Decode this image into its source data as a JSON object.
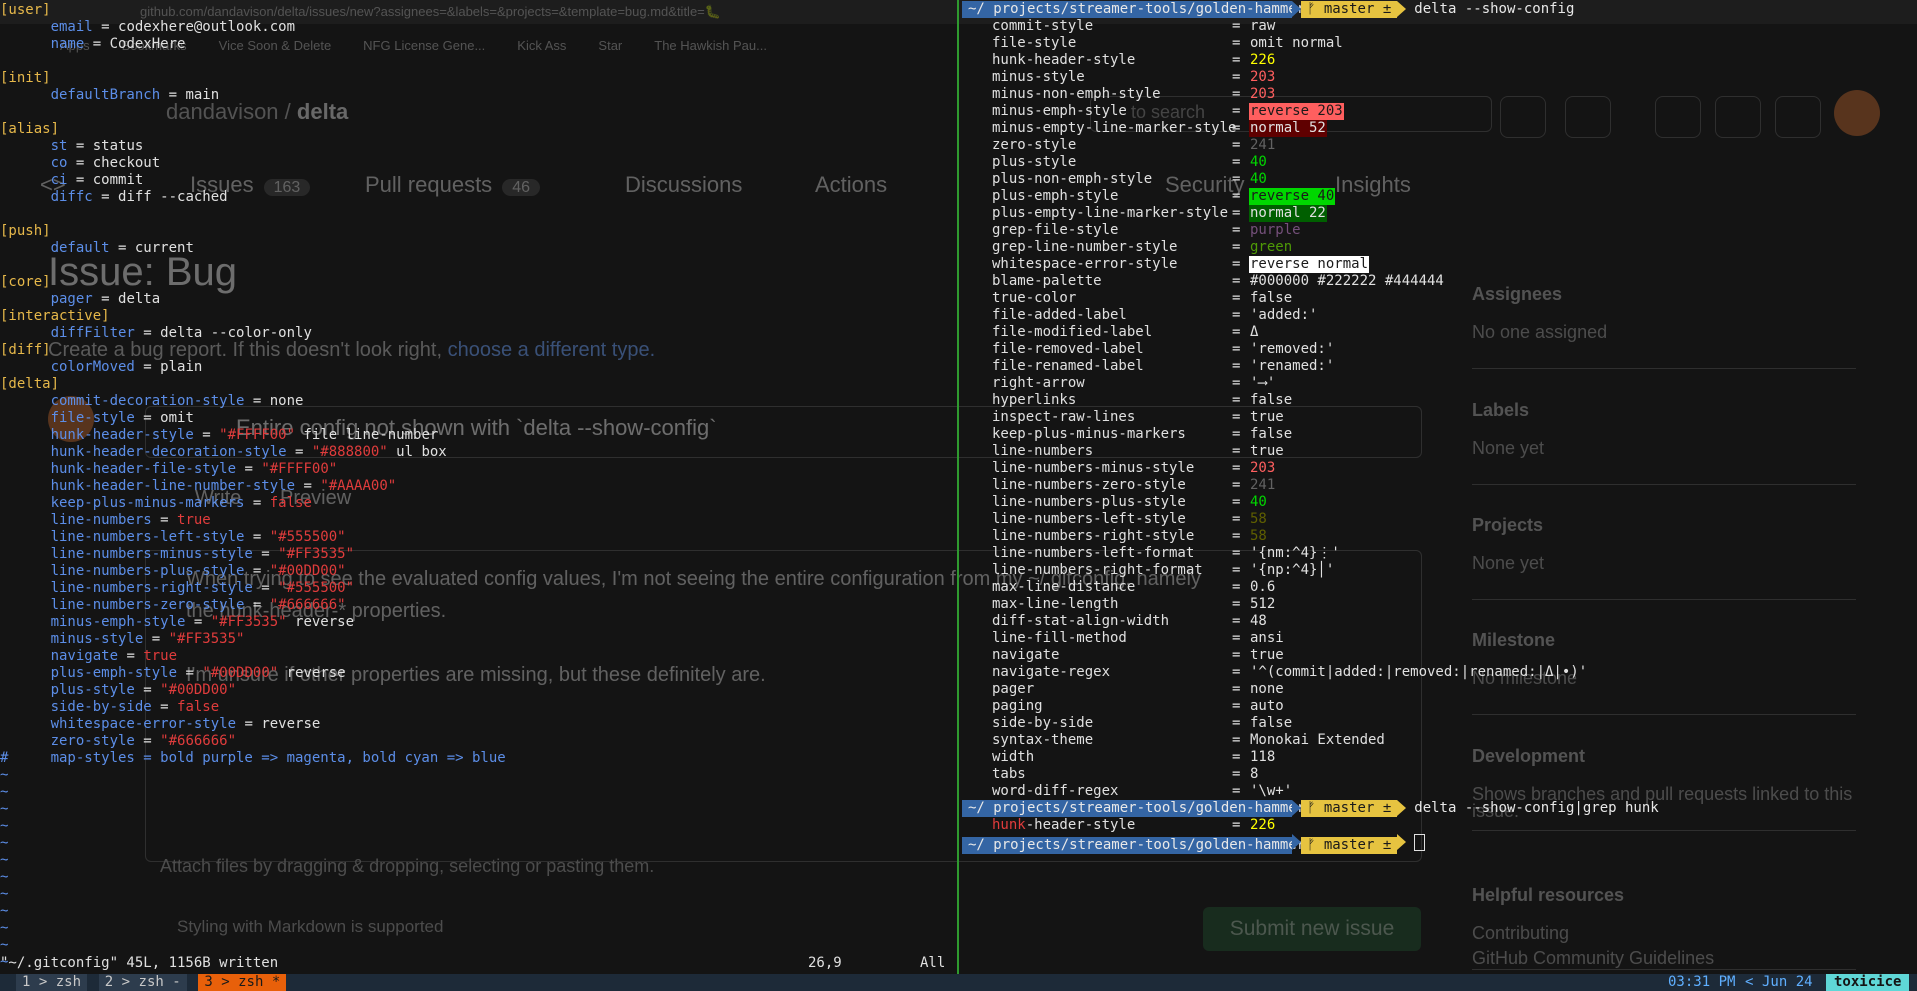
{
  "browser": {
    "url": "github.com/dandavison/delta/issues/new?assignees=&labels=&projects=&template=bug.md&title=🐛",
    "bookmarks": [
      "Apps",
      "Bookmarks",
      "Vice Soon & Delete",
      "NFG License Gene...",
      "Kick Ass",
      "Star",
      "The Hawkish Pau..."
    ],
    "owner": "dandavison",
    "repo_sep": "/",
    "repo": "delta",
    "search_placeholder": "to search",
    "nav": [
      {
        "label": "<>",
        "count": ""
      },
      {
        "label": "Issues",
        "count": "163"
      },
      {
        "label": "Pull requests",
        "count": "46"
      },
      {
        "label": "Discussions",
        "count": ""
      },
      {
        "label": "Actions",
        "count": ""
      },
      {
        "label": "Security",
        "count": ""
      },
      {
        "label": "Insights",
        "count": ""
      }
    ],
    "issue_title": "Issue: Bug",
    "issue_sub": "Create a bug report. If this doesn't look right,",
    "issue_sub_link": "choose a different type.",
    "title_value": "Entire config not shown with `delta --show-config`",
    "tabs": [
      "Write",
      "Preview"
    ],
    "body_lines": [
      "When trying to see the evaluated config values, I'm not seeing the entire configuration from my ~/.gitconfig, namely",
      "the hunk-header-* properties.",
      "",
      "I'm unsure if other properties are missing, but these definitely are."
    ],
    "attach_text": "Attach files by dragging & dropping, selecting or pasting them.",
    "markdown_note": "Styling with Markdown is supported",
    "submit_label": "Submit new issue",
    "sidebar": [
      {
        "heading": "Assignees",
        "value": "No one assigned"
      },
      {
        "heading": "Labels",
        "value": "None yet"
      },
      {
        "heading": "Projects",
        "value": "None yet"
      },
      {
        "heading": "Milestone",
        "value": "No milestone"
      },
      {
        "heading": "Development",
        "value": "Shows branches and pull requests linked to this issue."
      },
      {
        "heading": "Helpful resources",
        "value": "Contributing"
      },
      {
        "heading": "",
        "value": "GitHub Community Guidelines"
      }
    ]
  },
  "vim": {
    "lines": [
      [
        {
          "t": "[user]",
          "c": "hdr"
        }
      ],
      [
        {
          "t": "      email",
          "c": "key"
        },
        {
          "t": " = ",
          "c": "eq"
        },
        {
          "t": "codexhere@outlook.com",
          "c": "val"
        }
      ],
      [
        {
          "t": "      name",
          "c": "key"
        },
        {
          "t": " = ",
          "c": "eq"
        },
        {
          "t": "CodexHere",
          "c": "val"
        }
      ],
      [],
      [
        {
          "t": "[init]",
          "c": "hdr"
        }
      ],
      [
        {
          "t": "      defaultBranch",
          "c": "key"
        },
        {
          "t": " = ",
          "c": "eq"
        },
        {
          "t": "main",
          "c": "val"
        }
      ],
      [],
      [
        {
          "t": "[alias]",
          "c": "hdr"
        }
      ],
      [
        {
          "t": "      st",
          "c": "key"
        },
        {
          "t": " = ",
          "c": "eq"
        },
        {
          "t": "status",
          "c": "val"
        }
      ],
      [
        {
          "t": "      co",
          "c": "key"
        },
        {
          "t": " = ",
          "c": "eq"
        },
        {
          "t": "checkout",
          "c": "val"
        }
      ],
      [
        {
          "t": "      ci",
          "c": "key"
        },
        {
          "t": " = ",
          "c": "eq"
        },
        {
          "t": "commit",
          "c": "val"
        }
      ],
      [
        {
          "t": "      diffc",
          "c": "key"
        },
        {
          "t": " = ",
          "c": "eq"
        },
        {
          "t": "diff --cached",
          "c": "val"
        }
      ],
      [],
      [
        {
          "t": "[push]",
          "c": "hdr"
        }
      ],
      [
        {
          "t": "      default",
          "c": "key"
        },
        {
          "t": " = ",
          "c": "eq"
        },
        {
          "t": "current",
          "c": "val"
        }
      ],
      [],
      [
        {
          "t": "[core]",
          "c": "hdr"
        }
      ],
      [
        {
          "t": "      pager",
          "c": "key"
        },
        {
          "t": " = ",
          "c": "eq"
        },
        {
          "t": "delta",
          "c": "val"
        }
      ],
      [
        {
          "t": "[interactive]",
          "c": "hdr"
        }
      ],
      [
        {
          "t": "      diffFilter",
          "c": "key"
        },
        {
          "t": " = ",
          "c": "eq"
        },
        {
          "t": "delta --color-only",
          "c": "val"
        }
      ],
      [
        {
          "t": "[diff]",
          "c": "hdr"
        }
      ],
      [
        {
          "t": "      colorMoved",
          "c": "key"
        },
        {
          "t": " = ",
          "c": "eq"
        },
        {
          "t": "plain",
          "c": "val"
        }
      ],
      [
        {
          "t": "[delta]",
          "c": "hdr"
        }
      ],
      [
        {
          "t": "      commit-decoration-style",
          "c": "key"
        },
        {
          "t": " = ",
          "c": "eq"
        },
        {
          "t": "none",
          "c": "val"
        }
      ],
      [
        {
          "t": "      file-style",
          "c": "key"
        },
        {
          "t": " = ",
          "c": "eq"
        },
        {
          "t": "omit",
          "c": "val"
        }
      ],
      [
        {
          "t": "      hunk-header-style",
          "c": "key"
        },
        {
          "t": " = ",
          "c": "eq"
        },
        {
          "t": "\"#FFFF00\"",
          "c": "str"
        },
        {
          "t": " file line-number",
          "c": "val"
        }
      ],
      [
        {
          "t": "      hunk-header-decoration-style",
          "c": "key"
        },
        {
          "t": " = ",
          "c": "eq"
        },
        {
          "t": "\"#888800\"",
          "c": "str"
        },
        {
          "t": " ul box",
          "c": "val"
        }
      ],
      [
        {
          "t": "      hunk-header-file-style",
          "c": "key"
        },
        {
          "t": " = ",
          "c": "eq"
        },
        {
          "t": "\"#FFFF00\"",
          "c": "str"
        }
      ],
      [
        {
          "t": "      hunk-header-line-number-style",
          "c": "key"
        },
        {
          "t": " = ",
          "c": "eq"
        },
        {
          "t": "\"#AAAA00\"",
          "c": "str"
        }
      ],
      [
        {
          "t": "      keep-plus-minus-markers",
          "c": "key"
        },
        {
          "t": " = ",
          "c": "eq"
        },
        {
          "t": "false",
          "c": "bool"
        }
      ],
      [
        {
          "t": "      line-numbers",
          "c": "key"
        },
        {
          "t": " = ",
          "c": "eq"
        },
        {
          "t": "true",
          "c": "bool"
        }
      ],
      [
        {
          "t": "      line-numbers-left-style",
          "c": "key"
        },
        {
          "t": " = ",
          "c": "eq"
        },
        {
          "t": "\"#555500\"",
          "c": "str"
        }
      ],
      [
        {
          "t": "      line-numbers-minus-style",
          "c": "key"
        },
        {
          "t": " = ",
          "c": "eq"
        },
        {
          "t": "\"#FF3535\"",
          "c": "str"
        }
      ],
      [
        {
          "t": "      line-numbers-plus-style",
          "c": "key"
        },
        {
          "t": " = ",
          "c": "eq"
        },
        {
          "t": "\"#00DD00\"",
          "c": "str"
        }
      ],
      [
        {
          "t": "      line-numbers-right-style",
          "c": "key"
        },
        {
          "t": " = ",
          "c": "eq"
        },
        {
          "t": "\"#555500\"",
          "c": "str"
        }
      ],
      [
        {
          "t": "      line-numbers-zero-style",
          "c": "key"
        },
        {
          "t": " = ",
          "c": "eq"
        },
        {
          "t": "\"#666666\"",
          "c": "str"
        }
      ],
      [
        {
          "t": "      minus-emph-style",
          "c": "key"
        },
        {
          "t": " = ",
          "c": "eq"
        },
        {
          "t": "\"#FF3535\"",
          "c": "str"
        },
        {
          "t": " reverse",
          "c": "val"
        }
      ],
      [
        {
          "t": "      minus-style",
          "c": "key"
        },
        {
          "t": " = ",
          "c": "eq"
        },
        {
          "t": "\"#FF3535\"",
          "c": "str"
        }
      ],
      [
        {
          "t": "      navigate",
          "c": "key"
        },
        {
          "t": " = ",
          "c": "eq"
        },
        {
          "t": "true",
          "c": "bool"
        }
      ],
      [
        {
          "t": "      plus-emph-style",
          "c": "key"
        },
        {
          "t": " = ",
          "c": "eq"
        },
        {
          "t": "\"#00DD00\"",
          "c": "str"
        },
        {
          "t": " reverse",
          "c": "val"
        }
      ],
      [
        {
          "t": "      plus-style",
          "c": "key"
        },
        {
          "t": " = ",
          "c": "eq"
        },
        {
          "t": "\"#00DD00\"",
          "c": "str"
        }
      ],
      [
        {
          "t": "      side-by-side",
          "c": "key"
        },
        {
          "t": " = ",
          "c": "eq"
        },
        {
          "t": "false",
          "c": "bool"
        }
      ],
      [
        {
          "t": "      whitespace-error-style",
          "c": "key"
        },
        {
          "t": " = ",
          "c": "eq"
        },
        {
          "t": "reverse",
          "c": "val"
        }
      ],
      [
        {
          "t": "      zero-style",
          "c": "key"
        },
        {
          "t": " = ",
          "c": "eq"
        },
        {
          "t": "\"#666666\"",
          "c": "str"
        }
      ],
      [
        {
          "t": "#     map-styles = bold purple => magenta, bold cyan => blue",
          "c": "cmt"
        }
      ]
    ],
    "tilde_count": 12,
    "tilde": "~",
    "status_file": "\"~/.gitconfig\" 45L, 1156B written",
    "status_pos": "26,9",
    "status_scroll": "All"
  },
  "delta": {
    "prompt_dir": "~/ projects/streamer-tools/golden-hammer",
    "prompt_branch": "ᚠ master ±",
    "cmd1": "delta --show-config",
    "config": [
      {
        "k": "commit-style",
        "v": "raw",
        "fg": "",
        "bg": ""
      },
      {
        "k": "file-style",
        "v": "omit normal",
        "fg": "",
        "bg": ""
      },
      {
        "k": "hunk-header-style",
        "v": "226",
        "fg": "#ffff00",
        "bg": ""
      },
      {
        "k": "minus-style",
        "v": "203",
        "fg": "#ff5f5f",
        "bg": ""
      },
      {
        "k": "minus-non-emph-style",
        "v": "203",
        "fg": "#ff5f5f",
        "bg": ""
      },
      {
        "k": "minus-emph-style",
        "v": "reverse 203",
        "fg": "#1a1a1a",
        "bg": "#ff5f5f"
      },
      {
        "k": "minus-empty-line-marker-style",
        "v": "normal 52",
        "fg": "#e0e0e0",
        "bg": "#5f0000"
      },
      {
        "k": "zero-style",
        "v": "241",
        "fg": "#626262",
        "bg": ""
      },
      {
        "k": "plus-style",
        "v": "40",
        "fg": "#00d700",
        "bg": ""
      },
      {
        "k": "plus-non-emph-style",
        "v": "40",
        "fg": "#00d700",
        "bg": ""
      },
      {
        "k": "plus-emph-style",
        "v": "reverse 40",
        "fg": "#1a1a1a",
        "bg": "#00d700"
      },
      {
        "k": "plus-empty-line-marker-style",
        "v": "normal 22",
        "fg": "#e0e0e0",
        "bg": "#005f00"
      },
      {
        "k": "grep-file-style",
        "v": "purple",
        "fg": "#75507b",
        "bg": ""
      },
      {
        "k": "grep-line-number-style",
        "v": "green",
        "fg": "#4e9a06",
        "bg": ""
      },
      {
        "k": "whitespace-error-style",
        "v": "reverse normal",
        "fg": "#1a1a1a",
        "bg": "#ffffff"
      },
      {
        "k": "blame-palette",
        "v": "#000000 #222222 #444444",
        "fg": "",
        "bg": ""
      },
      {
        "k": "true-color",
        "v": "false",
        "fg": "",
        "bg": ""
      },
      {
        "k": "file-added-label",
        "v": "'added:'",
        "fg": "",
        "bg": ""
      },
      {
        "k": "file-modified-label",
        "v": "Δ",
        "fg": "",
        "bg": ""
      },
      {
        "k": "file-removed-label",
        "v": "'removed:'",
        "fg": "",
        "bg": ""
      },
      {
        "k": "file-renamed-label",
        "v": "'renamed:'",
        "fg": "",
        "bg": ""
      },
      {
        "k": "right-arrow",
        "v": "'⟶'",
        "fg": "",
        "bg": ""
      },
      {
        "k": "hyperlinks",
        "v": "false",
        "fg": "",
        "bg": ""
      },
      {
        "k": "inspect-raw-lines",
        "v": "true",
        "fg": "",
        "bg": ""
      },
      {
        "k": "keep-plus-minus-markers",
        "v": "false",
        "fg": "",
        "bg": ""
      },
      {
        "k": "line-numbers",
        "v": "true",
        "fg": "",
        "bg": ""
      },
      {
        "k": "line-numbers-minus-style",
        "v": "203",
        "fg": "#ff5f5f",
        "bg": ""
      },
      {
        "k": "line-numbers-zero-style",
        "v": "241",
        "fg": "#626262",
        "bg": ""
      },
      {
        "k": "line-numbers-plus-style",
        "v": "40",
        "fg": "#00d700",
        "bg": ""
      },
      {
        "k": "line-numbers-left-style",
        "v": "58",
        "fg": "#5f5f00",
        "bg": ""
      },
      {
        "k": "line-numbers-right-style",
        "v": "58",
        "fg": "#5f5f00",
        "bg": ""
      },
      {
        "k": "line-numbers-left-format",
        "v": "'{nm:^4}⋮'",
        "fg": "",
        "bg": ""
      },
      {
        "k": "line-numbers-right-format",
        "v": "'{np:^4}│'",
        "fg": "",
        "bg": ""
      },
      {
        "k": "max-line-distance",
        "v": "0.6",
        "fg": "",
        "bg": ""
      },
      {
        "k": "max-line-length",
        "v": "512",
        "fg": "",
        "bg": ""
      },
      {
        "k": "diff-stat-align-width",
        "v": "48",
        "fg": "",
        "bg": ""
      },
      {
        "k": "line-fill-method",
        "v": "ansi",
        "fg": "",
        "bg": ""
      },
      {
        "k": "navigate",
        "v": "true",
        "fg": "",
        "bg": ""
      },
      {
        "k": "navigate-regex",
        "v": "'^(commit|added:|removed:|renamed:|Δ|•)'",
        "fg": "",
        "bg": ""
      },
      {
        "k": "pager",
        "v": "none",
        "fg": "",
        "bg": ""
      },
      {
        "k": "paging",
        "v": "auto",
        "fg": "",
        "bg": ""
      },
      {
        "k": "side-by-side",
        "v": "false",
        "fg": "",
        "bg": ""
      },
      {
        "k": "syntax-theme",
        "v": "Monokai Extended",
        "fg": "",
        "bg": ""
      },
      {
        "k": "width",
        "v": "118",
        "fg": "",
        "bg": ""
      },
      {
        "k": "tabs",
        "v": "8",
        "fg": "",
        "bg": ""
      },
      {
        "k": "word-diff-regex",
        "v": "'\\w+'",
        "fg": "",
        "bg": ""
      }
    ],
    "cmd2": "delta --show-config|grep hunk",
    "grep_match": "hunk",
    "grep_rest": "-header-style",
    "grep_value": "226"
  },
  "tmux": {
    "windows": [
      {
        "label": "1 > zsh",
        "active": false
      },
      {
        "label": "2 > zsh -",
        "active": false
      },
      {
        "label": "3 > zsh *",
        "active": true
      }
    ],
    "time": "03:31 PM",
    "date": "Jun 24",
    "host": "toxicice"
  },
  "colors": {
    "terminal_bg": "#141414",
    "vim_header": "#e6b84a",
    "vim_key": "#5c8ee8",
    "vim_string": "#e03c3c",
    "prompt_dir_bg": "#3465a4",
    "prompt_branch_bg": "#e6c340",
    "tmux_active": "#e8600a",
    "tmux_host_bg": "#5fd7d7",
    "pane_divider": "#2f9a2f"
  }
}
